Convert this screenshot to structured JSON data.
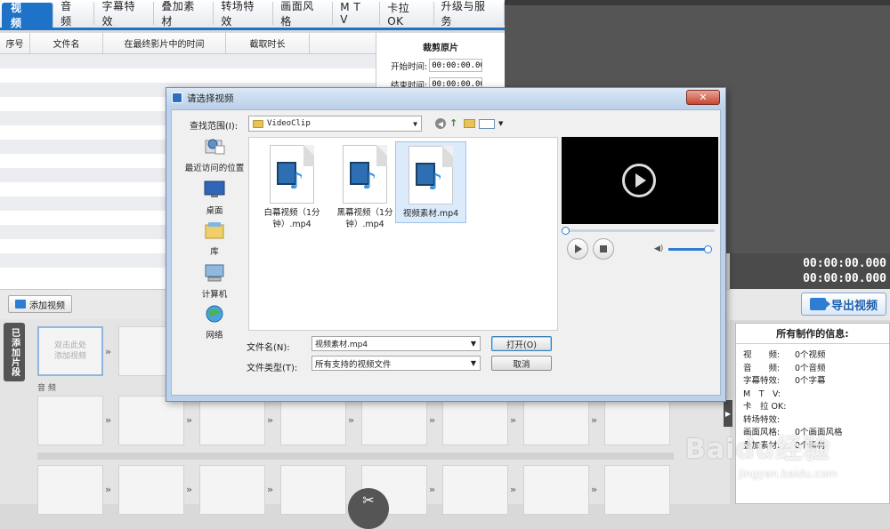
{
  "tabs": [
    "视 频",
    "音 频",
    "字幕特效",
    "叠加素材",
    "转场特效",
    "画面风格",
    "M T V",
    "卡拉OK",
    "升级与服务"
  ],
  "list": {
    "headers": [
      "序号",
      "文件名",
      "在最终影片中的时间",
      "截取时长"
    ]
  },
  "crop": {
    "title": "裁剪原片",
    "start_label": "开始时间:",
    "start_value": "00:00:00.000",
    "end_label": "结束时间:",
    "end_value": "00:00:00.000"
  },
  "timecode": {
    "current": "00:00:00.000",
    "total": "00:00:00.000"
  },
  "export_label": "导出视频",
  "add_video_label": "添加视频",
  "side_tab_label": "已添加片段",
  "first_clip_label": "双击此处\n添加视频",
  "audio_label": "音 频",
  "info": {
    "title": "所有制作的信息:",
    "rows": [
      {
        "k": "视　　频:",
        "v": "0个视频"
      },
      {
        "k": "音　　频:",
        "v": "0个音频"
      },
      {
        "k": "字幕特效:",
        "v": "0个字幕"
      },
      {
        "k": "M　T　V:",
        "v": ""
      },
      {
        "k": "卡　拉 OK:",
        "v": ""
      },
      {
        "k": "转场特效:",
        "v": ""
      },
      {
        "k": "画面风格:",
        "v": "0个画面风格"
      },
      {
        "k": "叠加素材:",
        "v": "0个素材"
      }
    ]
  },
  "dialog": {
    "title": "请选择视频",
    "look_in_label": "查找范围(I):",
    "look_in_value": "VideoClip",
    "places": [
      "最近访问的位置",
      "桌面",
      "库",
      "计算机",
      "网络"
    ],
    "files": [
      {
        "name": "白幕视频（1分钟）.mp4",
        "selected": false
      },
      {
        "name": "黑幕视频（1分钟）.mp4",
        "selected": false
      },
      {
        "name": "视频素材.mp4",
        "selected": true
      }
    ],
    "filename_label": "文件名(N):",
    "filename_value": "视频素材.mp4",
    "filetype_label": "文件类型(T):",
    "filetype_value": "所有支持的视频文件",
    "open_label": "打开(O)",
    "cancel_label": "取消"
  },
  "watermark": {
    "main": "Baidu经验",
    "sub": "jingyan.baidu.com"
  },
  "colors": {
    "accent": "#1e72c8",
    "dialog_frame": "#bcd2ea"
  }
}
